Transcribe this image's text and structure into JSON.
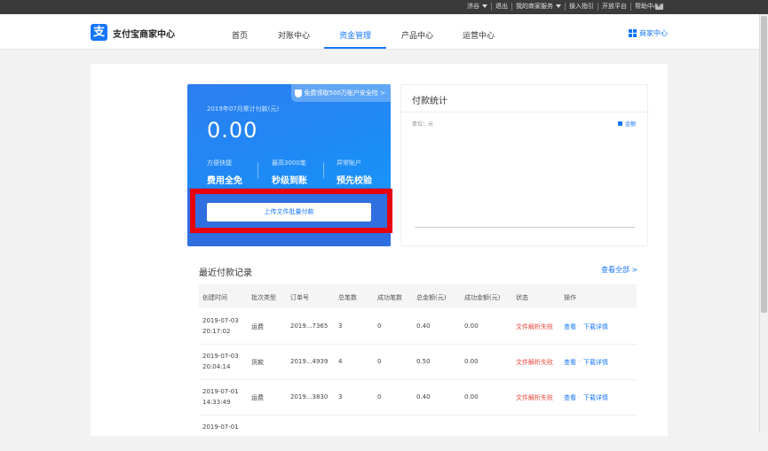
{
  "topbar": {
    "user": "济谷",
    "logout": "退出",
    "my_service": "我的商家服务",
    "guide": "操入指引",
    "open_platform": "开放平台",
    "help": "帮助中心"
  },
  "navbar": {
    "logo_text": "支付宝商家中心",
    "logo_glyph": "支",
    "links": [
      "首页",
      "对账中心",
      "资金管理",
      "产品中心",
      "运营中心"
    ],
    "active_index": 2,
    "merchant_center": "商家中心"
  },
  "blue_card": {
    "insurance_tag": "免费领取500万账户安全险 >",
    "label": "2019年07月累计付款(元)",
    "amount": "0.00",
    "features": [
      {
        "small": "方便快捷",
        "big": "费用全免"
      },
      {
        "small": "最高3000笔",
        "big": "秒级到账"
      },
      {
        "small": "异常账户",
        "big": "预先校验"
      }
    ],
    "upload_button": "上传文件批量付款"
  },
  "stats": {
    "title": "付款统计",
    "unit": "单位：元",
    "legend": "金额"
  },
  "records": {
    "title": "最近付款记录",
    "view_all": "查看全部",
    "columns": [
      "创建时间",
      "批次类型",
      "订单号",
      "总笔数",
      "成功笔数",
      "总金额(元)",
      "成功金额(元)",
      "状态",
      "操作"
    ],
    "rows": [
      {
        "date": "2019-07-03",
        "time": "20:17:02",
        "type": "运费",
        "order": "2019...7365",
        "total": "3",
        "success": "0",
        "amount": "0.40",
        "success_amount": "0.00",
        "status": "文件解析失败",
        "view": "查看",
        "download": "下载详情"
      },
      {
        "date": "2019-07-03",
        "time": "20:04:14",
        "type": "货款",
        "order": "2019...4939",
        "total": "4",
        "success": "0",
        "amount": "0.50",
        "success_amount": "0.00",
        "status": "文件解析失败",
        "view": "查看",
        "download": "下载详情"
      },
      {
        "date": "2019-07-01",
        "time": "14:33:49",
        "type": "运费",
        "order": "2019...3830",
        "total": "3",
        "success": "0",
        "amount": "0.40",
        "success_amount": "0.00",
        "status": "文件解析失败",
        "view": "查看",
        "download": "下载详情"
      },
      {
        "date": "2019-07-01",
        "time": "",
        "type": "",
        "order": "",
        "total": "",
        "success": "",
        "amount": "",
        "success_amount": "",
        "status": "",
        "view": "",
        "download": ""
      }
    ]
  },
  "colors": {
    "brand_blue": "#1677ff",
    "highlight_red": "#e8000b",
    "error_red": "#e8473b"
  }
}
